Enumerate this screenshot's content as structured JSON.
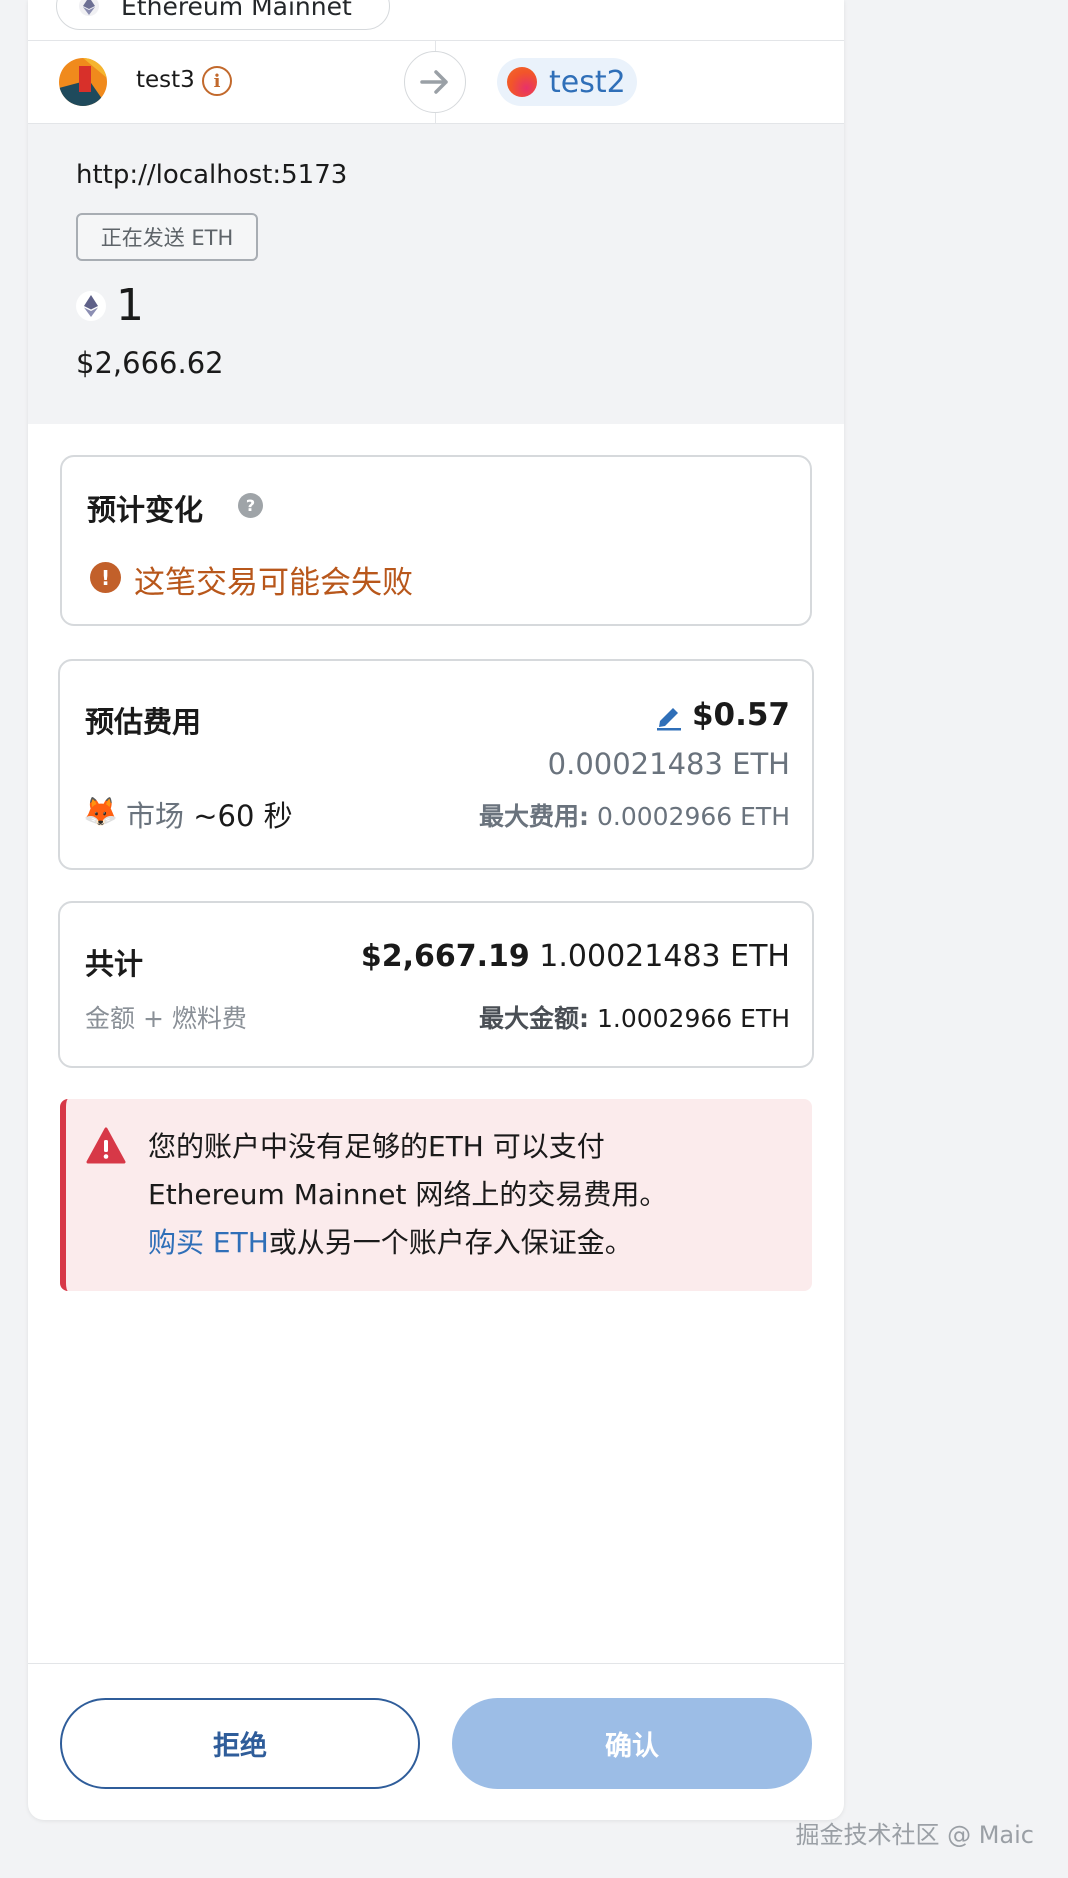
{
  "network": {
    "name": "Ethereum Mainnet",
    "icon": "ethereum-icon"
  },
  "accounts": {
    "from": {
      "name": "test3"
    },
    "to": {
      "name": "test2"
    }
  },
  "origin": {
    "url": "http://localhost:5173",
    "action_badge": "正在发送 ETH",
    "amount": "1",
    "fiat": "$2,666.62"
  },
  "simulation": {
    "title": "预计变化",
    "warning": "这笔交易可能会失败"
  },
  "fee": {
    "title": "预估费用",
    "fiat": "$0.57",
    "eth": "0.00021483 ETH",
    "speed_label": "市场",
    "speed_time": "~60 秒",
    "max_label": "最大费用:",
    "max_value": "0.0002966 ETH"
  },
  "total": {
    "title": "共计",
    "subtitle": "金额 + 燃料费",
    "fiat": "$2,667.19",
    "eth": "1.00021483 ETH",
    "max_label": "最大金额:",
    "max_value": "1.0002966 ETH"
  },
  "alert": {
    "line1": "您的账户中没有足够的ETH 可以支付",
    "line2": "Ethereum Mainnet 网络上的交易费用。",
    "link": "购买 ETH",
    "line3_rest": "或从另一个账户存入保证金。"
  },
  "buttons": {
    "reject": "拒绝",
    "confirm": "确认"
  },
  "watermark": "掘金技术社区 @ Maic",
  "colors": {
    "accent_blue": "#2f6fb8",
    "warning_orange": "#c2602a",
    "danger_red": "#d73847",
    "confirm_disabled": "#9cbde6"
  }
}
